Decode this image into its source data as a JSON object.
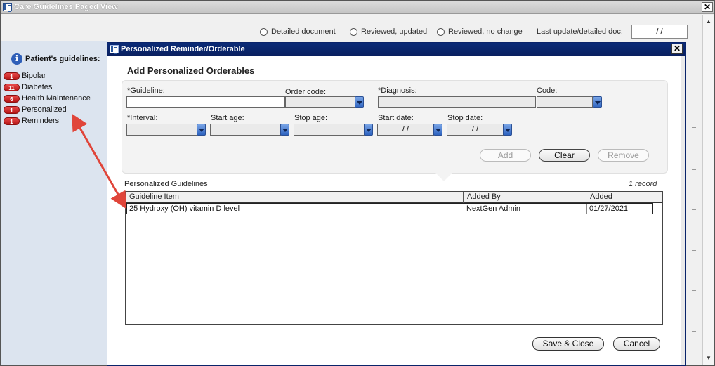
{
  "outer_window": {
    "title": "Care Guidelines Paged View",
    "close_glyph": "✕"
  },
  "toolbar": {
    "radio_options": [
      {
        "label": "Detailed document"
      },
      {
        "label": "Reviewed, updated"
      },
      {
        "label": "Reviewed, no change"
      }
    ],
    "last_update_label": "Last update/detailed doc:",
    "last_update_value": "  /  /"
  },
  "sidebar": {
    "header": "Patient's guidelines:",
    "info_glyph": "i",
    "items": [
      {
        "count": "1",
        "label": "Bipolar"
      },
      {
        "count": "11",
        "label": "Diabetes"
      },
      {
        "count": "6",
        "label": "Health Maintenance"
      },
      {
        "count": "1",
        "label": "Personalized"
      },
      {
        "count": "1",
        "label": "Reminders"
      }
    ]
  },
  "modal": {
    "title": "Personalized Reminder/Orderable",
    "close_glyph": "✕",
    "section_title": "Add Personalized Orderables",
    "fields": {
      "guideline_label": "*Guideline:",
      "order_code_label": "Order code:",
      "diagnosis_label": "*Diagnosis:",
      "code_label": "Code:",
      "interval_label": "*Interval:",
      "start_age_label": "Start age:",
      "stop_age_label": "Stop age:",
      "start_date_label": "Start date:",
      "stop_date_label": "Stop date:",
      "start_date_value": "  /  /",
      "stop_date_value": "  /  /"
    },
    "buttons": {
      "add": "Add",
      "clear": "Clear",
      "remove": "Remove",
      "save_close": "Save & Close",
      "cancel": "Cancel"
    },
    "grid": {
      "caption": "Personalized Guidelines",
      "record_count": "1 record",
      "columns": [
        "Guideline Item",
        "Added By",
        "Added"
      ],
      "rows": [
        {
          "item": "25 Hydroxy (OH) vitamin D level",
          "added_by": "NextGen Admin",
          "added": "01/27/2021"
        }
      ]
    }
  },
  "colors": {
    "modal_titlebar": "#0b2b77",
    "badge_red": "#d32f2f",
    "annotation_arrow": "#e0453a",
    "sidebar_bg": "#dce4ef"
  }
}
